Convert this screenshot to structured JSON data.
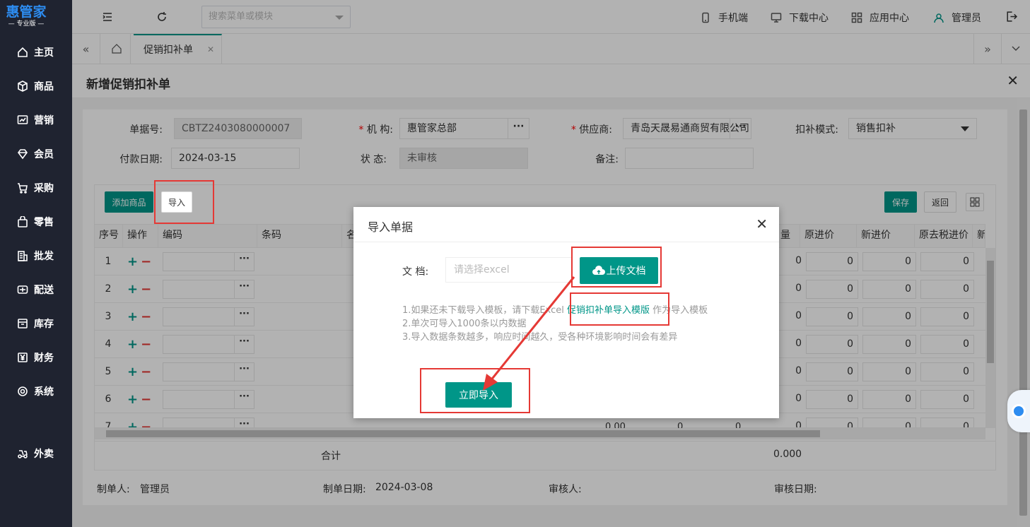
{
  "logo": {
    "main": "惠管家",
    "sub": "— 专业版 —"
  },
  "sidebar": {
    "items": [
      {
        "label": "主页",
        "icon": "home-icon"
      },
      {
        "label": "商品",
        "icon": "box-icon"
      },
      {
        "label": "营销",
        "icon": "chart-icon"
      },
      {
        "label": "会员",
        "icon": "diamond-icon"
      },
      {
        "label": "采购",
        "icon": "cart-icon"
      },
      {
        "label": "零售",
        "icon": "bag-icon"
      },
      {
        "label": "批发",
        "icon": "building-icon"
      },
      {
        "label": "配送",
        "icon": "truck-icon"
      },
      {
        "label": "库存",
        "icon": "inventory-icon"
      },
      {
        "label": "财务",
        "icon": "yen-icon"
      },
      {
        "label": "系统",
        "icon": "settings-icon"
      },
      {
        "label": "外卖",
        "icon": "delivery-icon"
      }
    ]
  },
  "topbar": {
    "search_placeholder": "搜索菜单或模块",
    "mobile": "手机端",
    "download": "下载中心",
    "apps": "应用中心",
    "user": "管理员"
  },
  "tabs": {
    "active": "促销扣补单"
  },
  "page": {
    "title": "新增促销扣补单"
  },
  "form": {
    "doc_no_label": "单据号:",
    "doc_no": "CBTZ2403080000007",
    "org_label": "机 构:",
    "org": "惠管家总部",
    "supplier_label": "供应商:",
    "supplier": "青岛天晟易通商贸有限公司",
    "mode_label": "扣补模式:",
    "mode": "销售扣补",
    "pay_date_label": "付款日期:",
    "pay_date": "2024-03-15",
    "status_label": "状 态:",
    "status": "未审核",
    "remark_label": "备注:",
    "remark": ""
  },
  "toolbar": {
    "add_product": "添加商品",
    "import": "导入",
    "save": "保存",
    "back": "返回"
  },
  "table": {
    "headers": [
      "序号",
      "操作",
      "编码",
      "条码",
      "名",
      "量",
      "原进价",
      "新进价",
      "原去税进价",
      "新去"
    ],
    "rows": [
      {
        "no": "1",
        "qty": "0",
        "old_price": "0",
        "new_price": "0",
        "old_tax_free": "0"
      },
      {
        "no": "2",
        "qty": "0",
        "old_price": "0",
        "new_price": "0",
        "old_tax_free": "0"
      },
      {
        "no": "3",
        "qty": "0",
        "old_price": "0",
        "new_price": "0",
        "old_tax_free": "0"
      },
      {
        "no": "4",
        "qty": "0",
        "old_price": "0",
        "new_price": "0",
        "old_tax_free": "0"
      },
      {
        "no": "5",
        "qty": "0",
        "old_price": "0",
        "new_price": "0",
        "old_tax_free": "0"
      },
      {
        "no": "6",
        "qty": "0",
        "old_price": "0",
        "new_price": "0",
        "old_tax_free": "0"
      },
      {
        "no": "7",
        "qty": "0",
        "old_price": "0",
        "new_price": "0",
        "old_tax_free": "0"
      }
    ],
    "partial_values": [
      "0.00",
      "0",
      "0"
    ],
    "total_label": "合计",
    "total_value": "0.000",
    "op_plus": "+",
    "op_minus": "−",
    "ellipsis": "···"
  },
  "footer": {
    "maker_label": "制单人:",
    "maker": "管理员",
    "make_date_label": "制单日期:",
    "make_date": "2024-03-08",
    "auditor_label": "审核人:",
    "audit_date_label": "审核日期:"
  },
  "dialog": {
    "title": "导入单据",
    "doc_label": "文 档:",
    "file_placeholder": "请选择excel",
    "upload": "上传文档",
    "tip1_prefix": "1.如果还未下载导入模板，请下载Excel ",
    "tip1_link": "促销扣补单导入模版",
    "tip1_suffix": " 作为导入模板",
    "tip2": "2.单次可导入1000条以内数据",
    "tip3": "3.导入数据条数越多，响应时间越久，受各种环境影响时间会有差异",
    "import_now": "立即导入"
  },
  "colors": {
    "accent": "#009688",
    "sidebar": "#1f2330",
    "highlight": "#e53935",
    "logo": "#2d8cf0"
  }
}
